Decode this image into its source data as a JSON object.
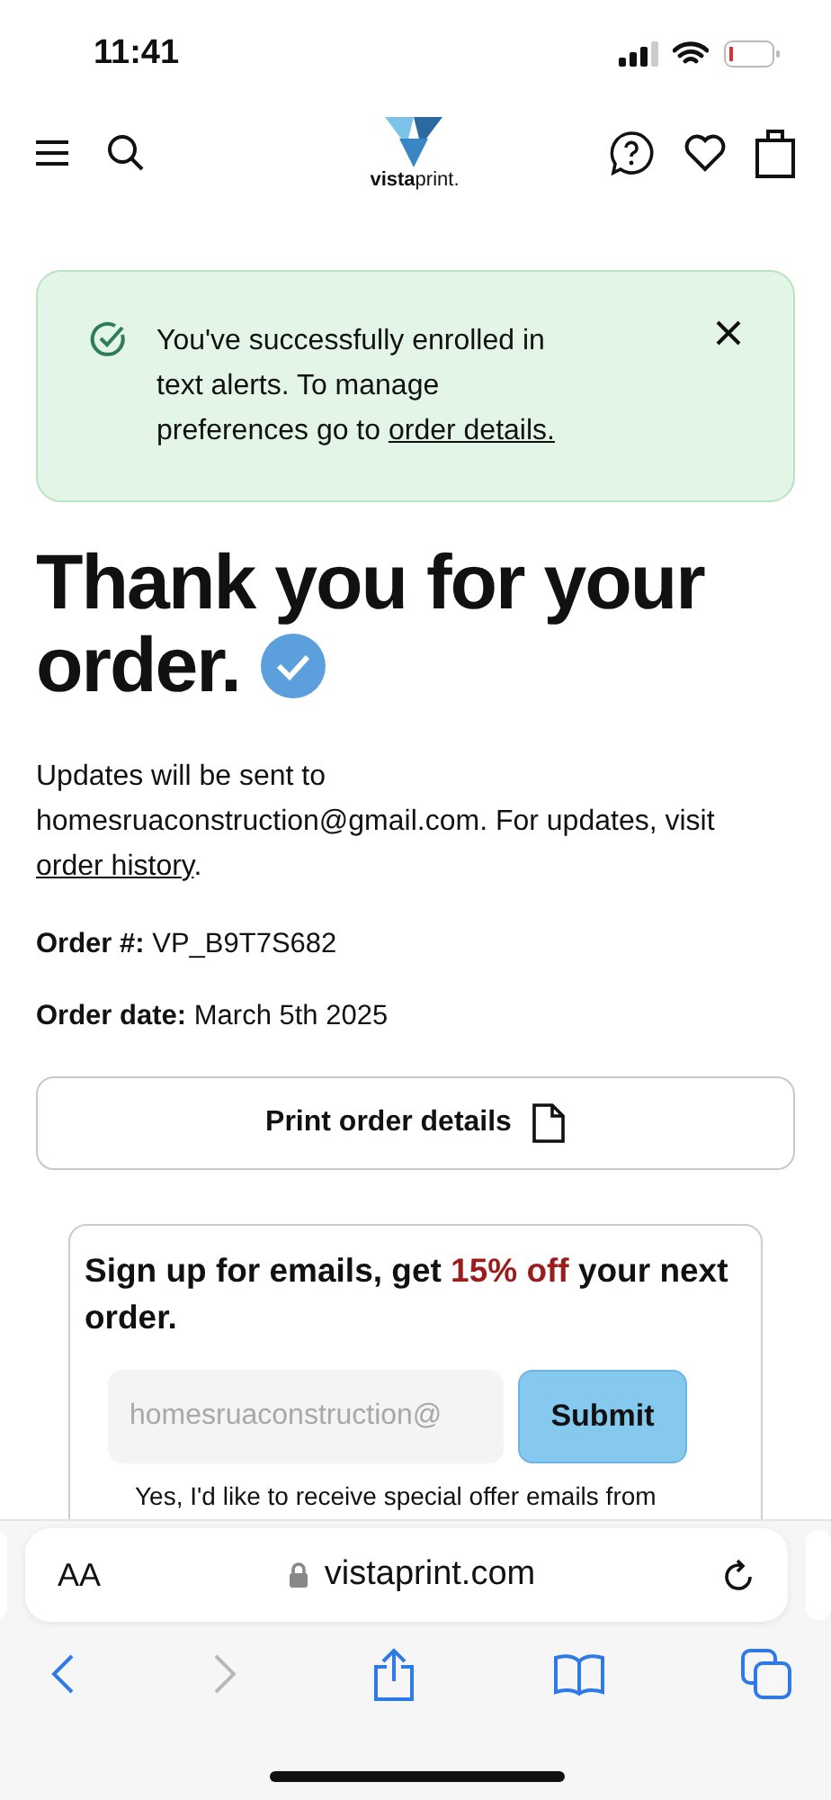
{
  "status_bar": {
    "time": "11:41"
  },
  "header": {
    "logo": "**vista**print."
  },
  "alert": {
    "text": "You've successfully enrolled in text alerts. To manage preferences go to ",
    "link": "order details."
  },
  "title": [
    "Thank you for your",
    "order."
  ],
  "updates": {
    "text": "Updates will be sent to homesruaconstruction@gmail.com. For updates, visit ",
    "link": "order history",
    "tail": "."
  },
  "order_info": [
    {
      "label": "Order #:",
      "value": "VP_B9T7S682"
    },
    {
      "label": "Order date:",
      "value": "March 5th 2025"
    }
  ],
  "print_button": "Print order details",
  "signup": {
    "heading_start": "Sign up for emails, get ",
    "highlight": "15% off",
    "heading_end": " your next order.",
    "placeholder": "homesruaconstruction@",
    "button": "Submit",
    "consent": "Yes, I'd like to receive special offer emails from"
  },
  "browser": {
    "text_size": "AA",
    "url": "vistaprint.com",
    "back_disabled": false,
    "forward_disabled": true
  }
}
